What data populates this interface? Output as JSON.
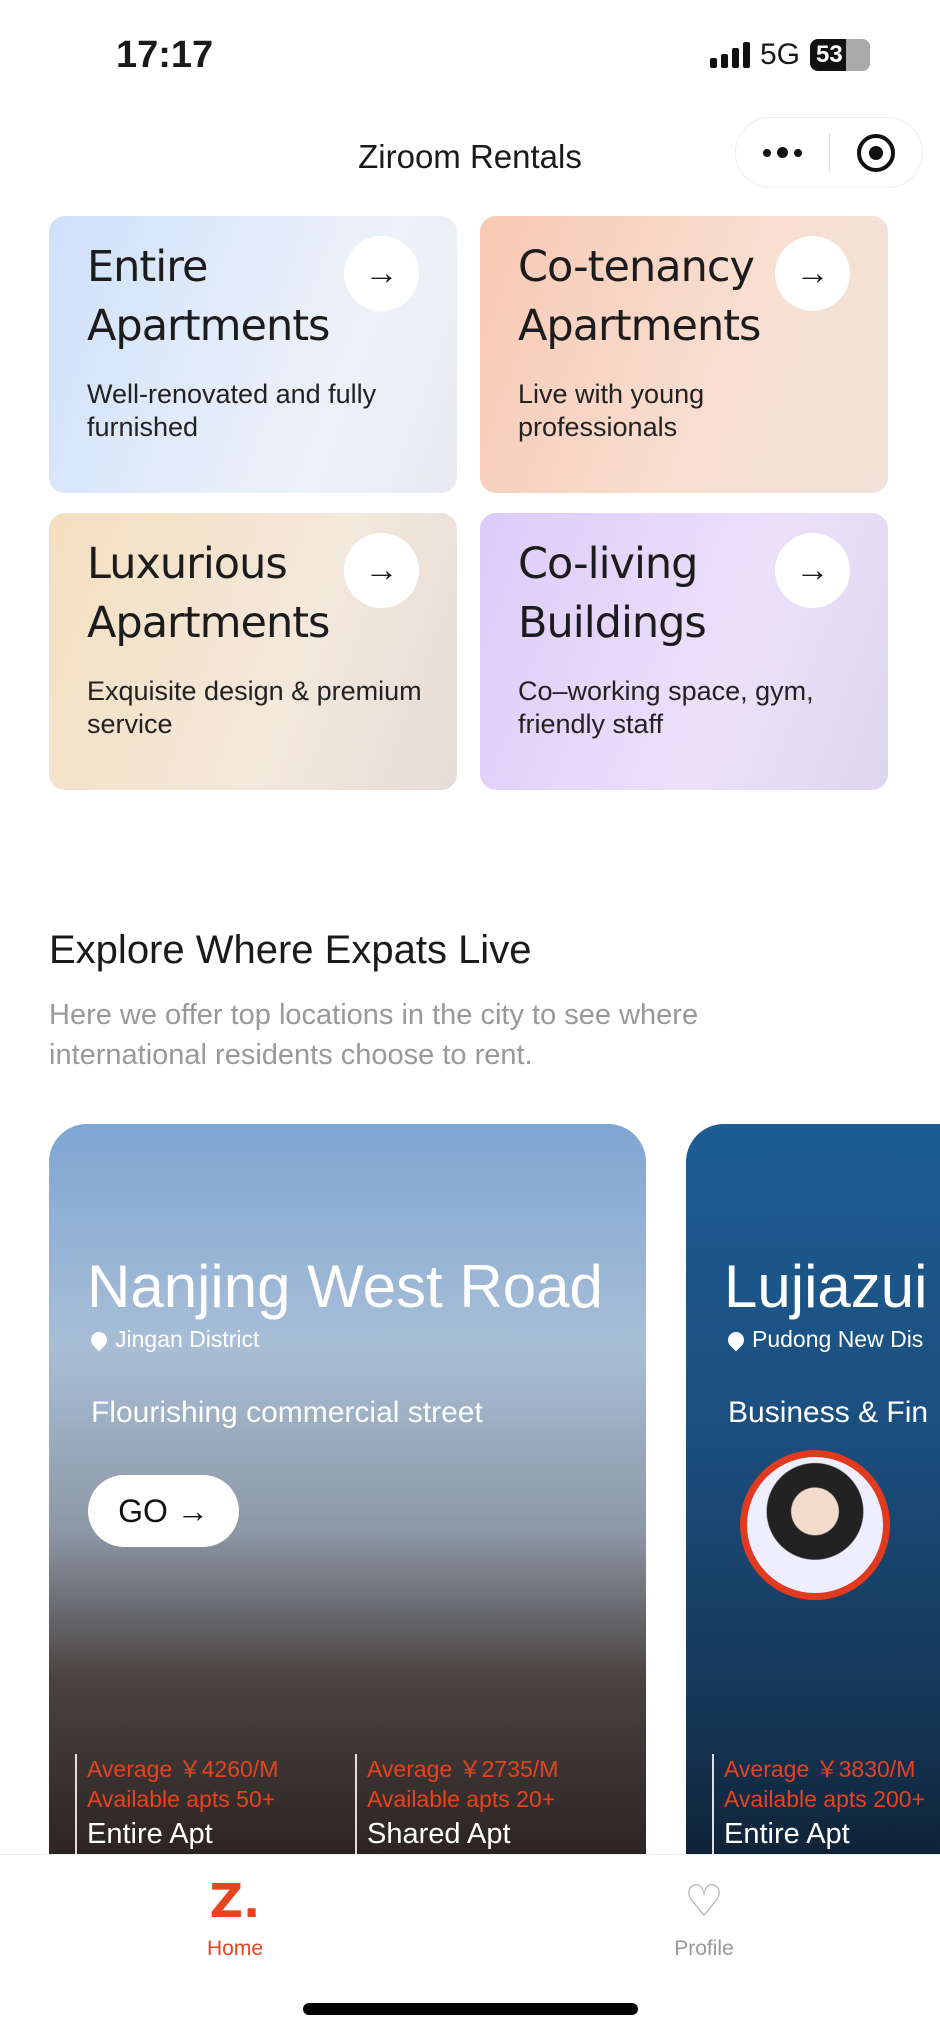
{
  "status_bar": {
    "time": "17:17",
    "network": "5G",
    "battery": "53"
  },
  "nav": {
    "title": "Ziroom Rentals",
    "more_icon": "more-dots-icon",
    "close_icon": "target-icon"
  },
  "categories": [
    {
      "title": "Entire Apartments",
      "desc": "Well-renovated and fully furnished",
      "bg": "#d6e4fb"
    },
    {
      "title": "Co-tenancy Apartments",
      "desc": "Live with young professionals",
      "bg": "#f9d3c1"
    },
    {
      "title": "Luxurious Apartments",
      "desc": "Exquisite design & premium service",
      "bg": "#f3e1c7"
    },
    {
      "title": "Co-living Buildings",
      "desc": "Co–working space, gym, friendly staff",
      "bg": "#e0d3f8"
    }
  ],
  "explore": {
    "title": "Explore Where Expats Live",
    "subtitle": "Here we offer top locations in the city to see where international residents choose to rent."
  },
  "locations": [
    {
      "name": "Nanjing West Road",
      "district": "Jingan District",
      "desc": "Flourishing commercial street",
      "go": "GO →",
      "stats": [
        {
          "avg": "Average ￥4260/M",
          "avail": "Available apts 50+",
          "type": "Entire Apt"
        },
        {
          "avg": "Average ￥2735/M",
          "avail": "Available apts 20+",
          "type": "Shared Apt"
        }
      ]
    },
    {
      "name": "Lujiazui",
      "district": "Pudong New Dis",
      "desc": "Business & Fin",
      "stats": [
        {
          "avg": "Average ￥3830/M",
          "avail": "Available apts 200+",
          "type": "Entire Apt"
        }
      ]
    }
  ],
  "tabbar": {
    "home": "Home",
    "profile": "Profile",
    "active_color": "#e8431f",
    "inactive_color": "#999999"
  }
}
